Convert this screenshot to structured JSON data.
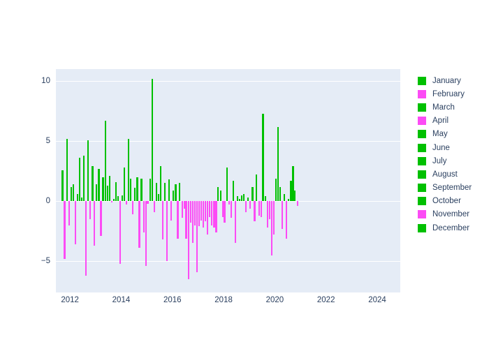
{
  "chart_data": {
    "type": "bar",
    "title": "",
    "xlabel": "",
    "ylabel": "",
    "xlim": [
      2011.45,
      2024.9
    ],
    "ylim": [
      -7.6,
      11.0
    ],
    "grid": true,
    "legend_position": "right",
    "x_ticks": [
      "2012",
      "2014",
      "2016",
      "2018",
      "2020",
      "2022",
      "2024"
    ],
    "x_tick_values": [
      2012,
      2014,
      2016,
      2018,
      2020,
      2022,
      2024
    ],
    "y_ticks": [
      "10",
      "5",
      "0",
      "−5"
    ],
    "y_tick_values": [
      10,
      5,
      0,
      -5
    ],
    "colors": {
      "positive": "#00c000",
      "negative": "#fc4bf5",
      "plot_background": "#e5ecf6",
      "paper_background": "#ffffff",
      "gridline": "#ffffff",
      "text": "#2a3f5f"
    },
    "legend": [
      {
        "label": "January",
        "color": "#00c000"
      },
      {
        "label": "February",
        "color": "#fc4bf5"
      },
      {
        "label": "March",
        "color": "#00c000"
      },
      {
        "label": "April",
        "color": "#fc4bf5"
      },
      {
        "label": "May",
        "color": "#00c000"
      },
      {
        "label": "June",
        "color": "#00c000"
      },
      {
        "label": "July",
        "color": "#00c000"
      },
      {
        "label": "August",
        "color": "#00c000"
      },
      {
        "label": "September",
        "color": "#00c000"
      },
      {
        "label": "October",
        "color": "#00c000"
      },
      {
        "label": "November",
        "color": "#fc4bf5"
      },
      {
        "label": "December",
        "color": "#00c000"
      }
    ],
    "x": [
      2011.71,
      2011.79,
      2011.88,
      2011.96,
      2012.04,
      2012.13,
      2012.21,
      2012.29,
      2012.38,
      2012.46,
      2012.54,
      2012.63,
      2012.71,
      2012.79,
      2012.88,
      2012.96,
      2013.04,
      2013.13,
      2013.21,
      2013.29,
      2013.38,
      2013.46,
      2013.54,
      2013.63,
      2013.71,
      2013.79,
      2013.88,
      2013.96,
      2014.04,
      2014.13,
      2014.21,
      2014.29,
      2014.38,
      2014.46,
      2014.54,
      2014.63,
      2014.71,
      2014.79,
      2014.88,
      2014.96,
      2015.04,
      2015.13,
      2015.21,
      2015.29,
      2015.38,
      2015.46,
      2015.54,
      2015.63,
      2015.71,
      2015.79,
      2015.88,
      2015.96,
      2016.04,
      2016.13,
      2016.21,
      2016.29,
      2016.38,
      2016.46,
      2016.54,
      2016.63,
      2016.71,
      2016.79,
      2016.88,
      2016.96,
      2017.04,
      2017.13,
      2017.21,
      2017.29,
      2017.38,
      2017.46,
      2017.54,
      2017.63,
      2017.71,
      2017.79,
      2017.88,
      2017.96,
      2018.04,
      2018.13,
      2018.21,
      2018.29,
      2018.38,
      2018.46,
      2018.54,
      2018.63,
      2018.71,
      2018.79,
      2018.88,
      2018.96,
      2019.04,
      2019.13,
      2019.21,
      2019.29,
      2019.38,
      2019.46,
      2019.54,
      2019.63,
      2019.71,
      2019.79,
      2019.88,
      2019.96,
      2020.04,
      2020.13,
      2020.21,
      2020.29,
      2020.38,
      2020.46,
      2020.54,
      2020.63,
      2020.71,
      2020.79,
      2020.88
    ],
    "values": [
      2.6,
      -4.8,
      5.2,
      -2.0,
      1.2,
      1.4,
      -3.6,
      0.6,
      3.6,
      0.3,
      3.8,
      -6.2,
      5.1,
      -1.5,
      2.9,
      -3.7,
      1.4,
      2.7,
      -2.9,
      2.0,
      6.7,
      1.3,
      2.1,
      -0.1,
      0.2,
      1.6,
      0.4,
      -5.2,
      0.5,
      2.8,
      -0.3,
      5.2,
      1.9,
      -1.1,
      1.1,
      2.0,
      -3.9,
      1.9,
      -2.6,
      -5.4,
      -0.2,
      1.9,
      10.2,
      -0.9,
      1.5,
      0.6,
      2.9,
      -3.2,
      1.5,
      -5.0,
      1.8,
      -1.6,
      0.9,
      1.4,
      -3.1,
      1.5,
      -1.4,
      -0.6,
      -3.1,
      -6.5,
      -1.8,
      -3.5,
      -2.0,
      -5.9,
      -2.1,
      -1.6,
      -2.2,
      -1.7,
      -2.8,
      -1.3,
      -2.0,
      -2.2,
      -2.6,
      1.2,
      0.9,
      -1.3,
      -1.8,
      2.8,
      -0.3,
      -1.4,
      1.7,
      -3.5,
      0.4,
      0.2,
      0.5,
      0.6,
      -0.9,
      0.3,
      -0.6,
      1.2,
      -1.7,
      2.2,
      -1.2,
      -1.3,
      7.3,
      0.4,
      -2.2,
      -1.5,
      -4.5,
      -2.8,
      1.9,
      6.2,
      1.2,
      -2.3,
      0.6,
      -3.1,
      0.2,
      1.7,
      2.9,
      0.9,
      -0.4
    ]
  }
}
